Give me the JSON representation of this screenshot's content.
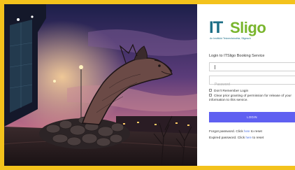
{
  "logo": {
    "it_text": "IT",
    "name_text": "Sligo",
    "subtitle": "An Institiúid Teicneolaíochta, Sligeach",
    "colors": {
      "it": "#1c6e86",
      "name": "#79b52d"
    }
  },
  "login": {
    "title": "Login to ITSligo Booking Service",
    "username": {
      "value": "",
      "placeholder": ""
    },
    "password": {
      "value": "",
      "placeholder": "Password"
    },
    "dont_remember_label": "Don't Remember Login",
    "clear_consent_label_line1": "Clear prior granting of permission for release of your",
    "clear_consent_label_line2": "information to this service.",
    "button_label": "LOGIN",
    "button_color": "#5f60f1"
  },
  "links": {
    "forgot_prefix": "Forgot password. Click ",
    "forgot_link": "here",
    "forgot_suffix": " to reset",
    "expired_prefix": "Expired password. Click ",
    "expired_link": "here",
    "expired_suffix": " to reset"
  },
  "frame_color": "#f3c21c"
}
